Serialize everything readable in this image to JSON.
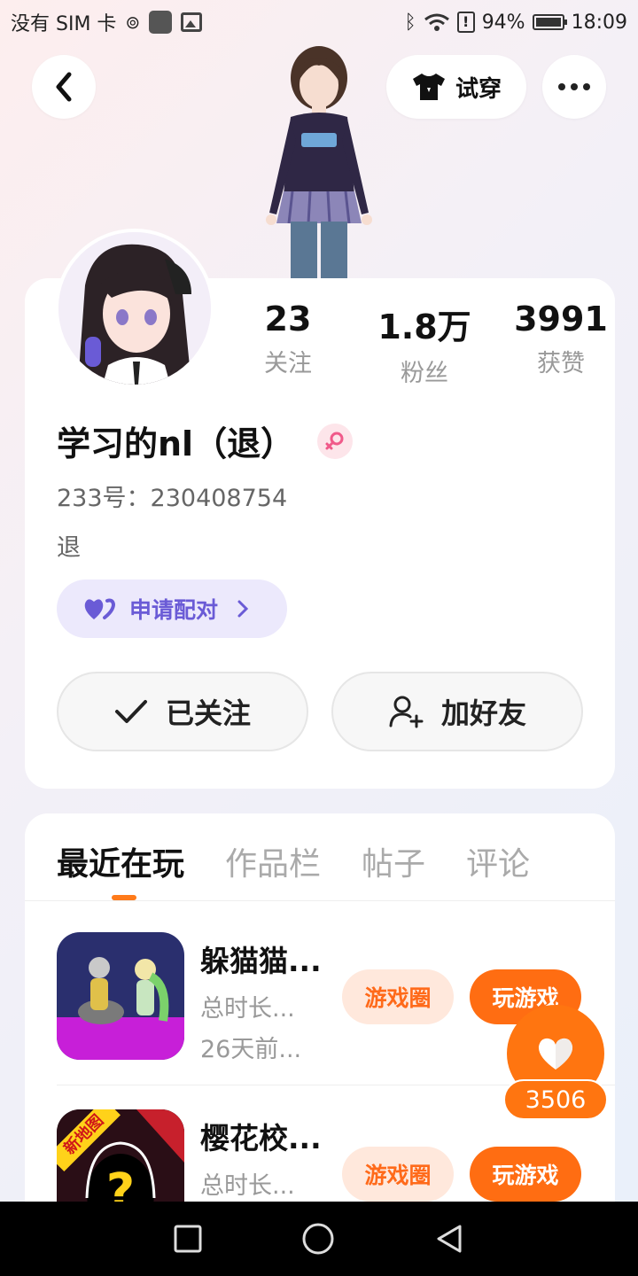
{
  "status_bar": {
    "carrier": "没有 SIM 卡",
    "battery": "94%",
    "time": "18:09"
  },
  "header": {
    "tryon_label": "试穿"
  },
  "profile": {
    "stats": [
      {
        "value": "23",
        "label": "关注"
      },
      {
        "value": "1.8万",
        "label": "粉丝"
      },
      {
        "value": "3991",
        "label": "获赞"
      }
    ],
    "username": "学习的nl（退）",
    "uid": "233号：230408754",
    "bio": "退",
    "match_label": "申请配对",
    "follow_label": "已关注",
    "add_friend_label": "加好友"
  },
  "tabs": [
    "最近在玩",
    "作品栏",
    "帖子",
    "评论"
  ],
  "games": [
    {
      "title": "躲猫猫...",
      "duration": "总时长...",
      "last_played": "26天前...",
      "circle_label": "游戏圈",
      "play_label": "玩游戏",
      "badge": ""
    },
    {
      "title": "樱花校...",
      "duration": "总时长...",
      "last_played": "",
      "circle_label": "游戏圈",
      "play_label": "玩游戏",
      "badge": "新地图"
    }
  ],
  "like": {
    "count": "3506"
  },
  "colors": {
    "accent": "#ff6d12",
    "match": "#6a5bd6",
    "gender": "#f05a8a"
  }
}
